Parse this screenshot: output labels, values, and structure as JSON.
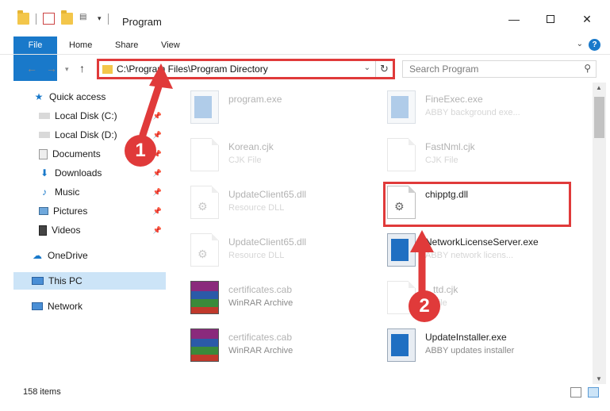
{
  "window": {
    "title": "Program"
  },
  "ribbon": {
    "tabs": [
      "File",
      "Home",
      "Share",
      "View"
    ],
    "help_label": "?"
  },
  "address": {
    "path": "C:\\Program Files\\Program Directory"
  },
  "search": {
    "placeholder": "Search Program"
  },
  "sidebar": {
    "items": [
      {
        "label": "Quick access",
        "icon": "star-icon"
      },
      {
        "label": "Local Disk (C:)",
        "icon": "drive-icon"
      },
      {
        "label": "Local Disk (D:)",
        "icon": "drive-icon"
      },
      {
        "label": "Documents",
        "icon": "documents-icon"
      },
      {
        "label": "Downloads",
        "icon": "download-icon"
      },
      {
        "label": "Music",
        "icon": "music-icon"
      },
      {
        "label": "Pictures",
        "icon": "pictures-icon"
      },
      {
        "label": "Videos",
        "icon": "videos-icon"
      },
      {
        "label": "OneDrive",
        "icon": "cloud-icon"
      },
      {
        "label": "This PC",
        "icon": "pc-icon"
      },
      {
        "label": "Network",
        "icon": "network-icon"
      }
    ]
  },
  "files": [
    {
      "name": "program.exe",
      "type": ""
    },
    {
      "name": "FineExec.exe",
      "type": "ABBY background exe..."
    },
    {
      "name": "Korean.cjk",
      "type": "CJK File"
    },
    {
      "name": "FastNml.cjk",
      "type": "CJK File"
    },
    {
      "name": "UpdateClient65.dll",
      "type": "Resource DLL"
    },
    {
      "name": "chipptg.dll",
      "type": ""
    },
    {
      "name": "UpdateClient65.dll",
      "type": "Resource DLL"
    },
    {
      "name": "NetworkLicenseServer.exe",
      "type": "ABBY network licens..."
    },
    {
      "name": "certificates.cab",
      "type": "WinRAR Archive"
    },
    {
      "name": "ttd.cjk",
      "type": "File"
    },
    {
      "name": "certificates.cab",
      "type": "WinRAR Archive"
    },
    {
      "name": "UpdateInstaller.exe",
      "type": "ABBY updates installer"
    }
  ],
  "status": {
    "count": "158 items"
  },
  "annotations": {
    "step1": "1",
    "step2": "2"
  },
  "colors": {
    "accent": "#1979ca",
    "highlight": "#e03a3a",
    "selection": "#cce4f7"
  }
}
